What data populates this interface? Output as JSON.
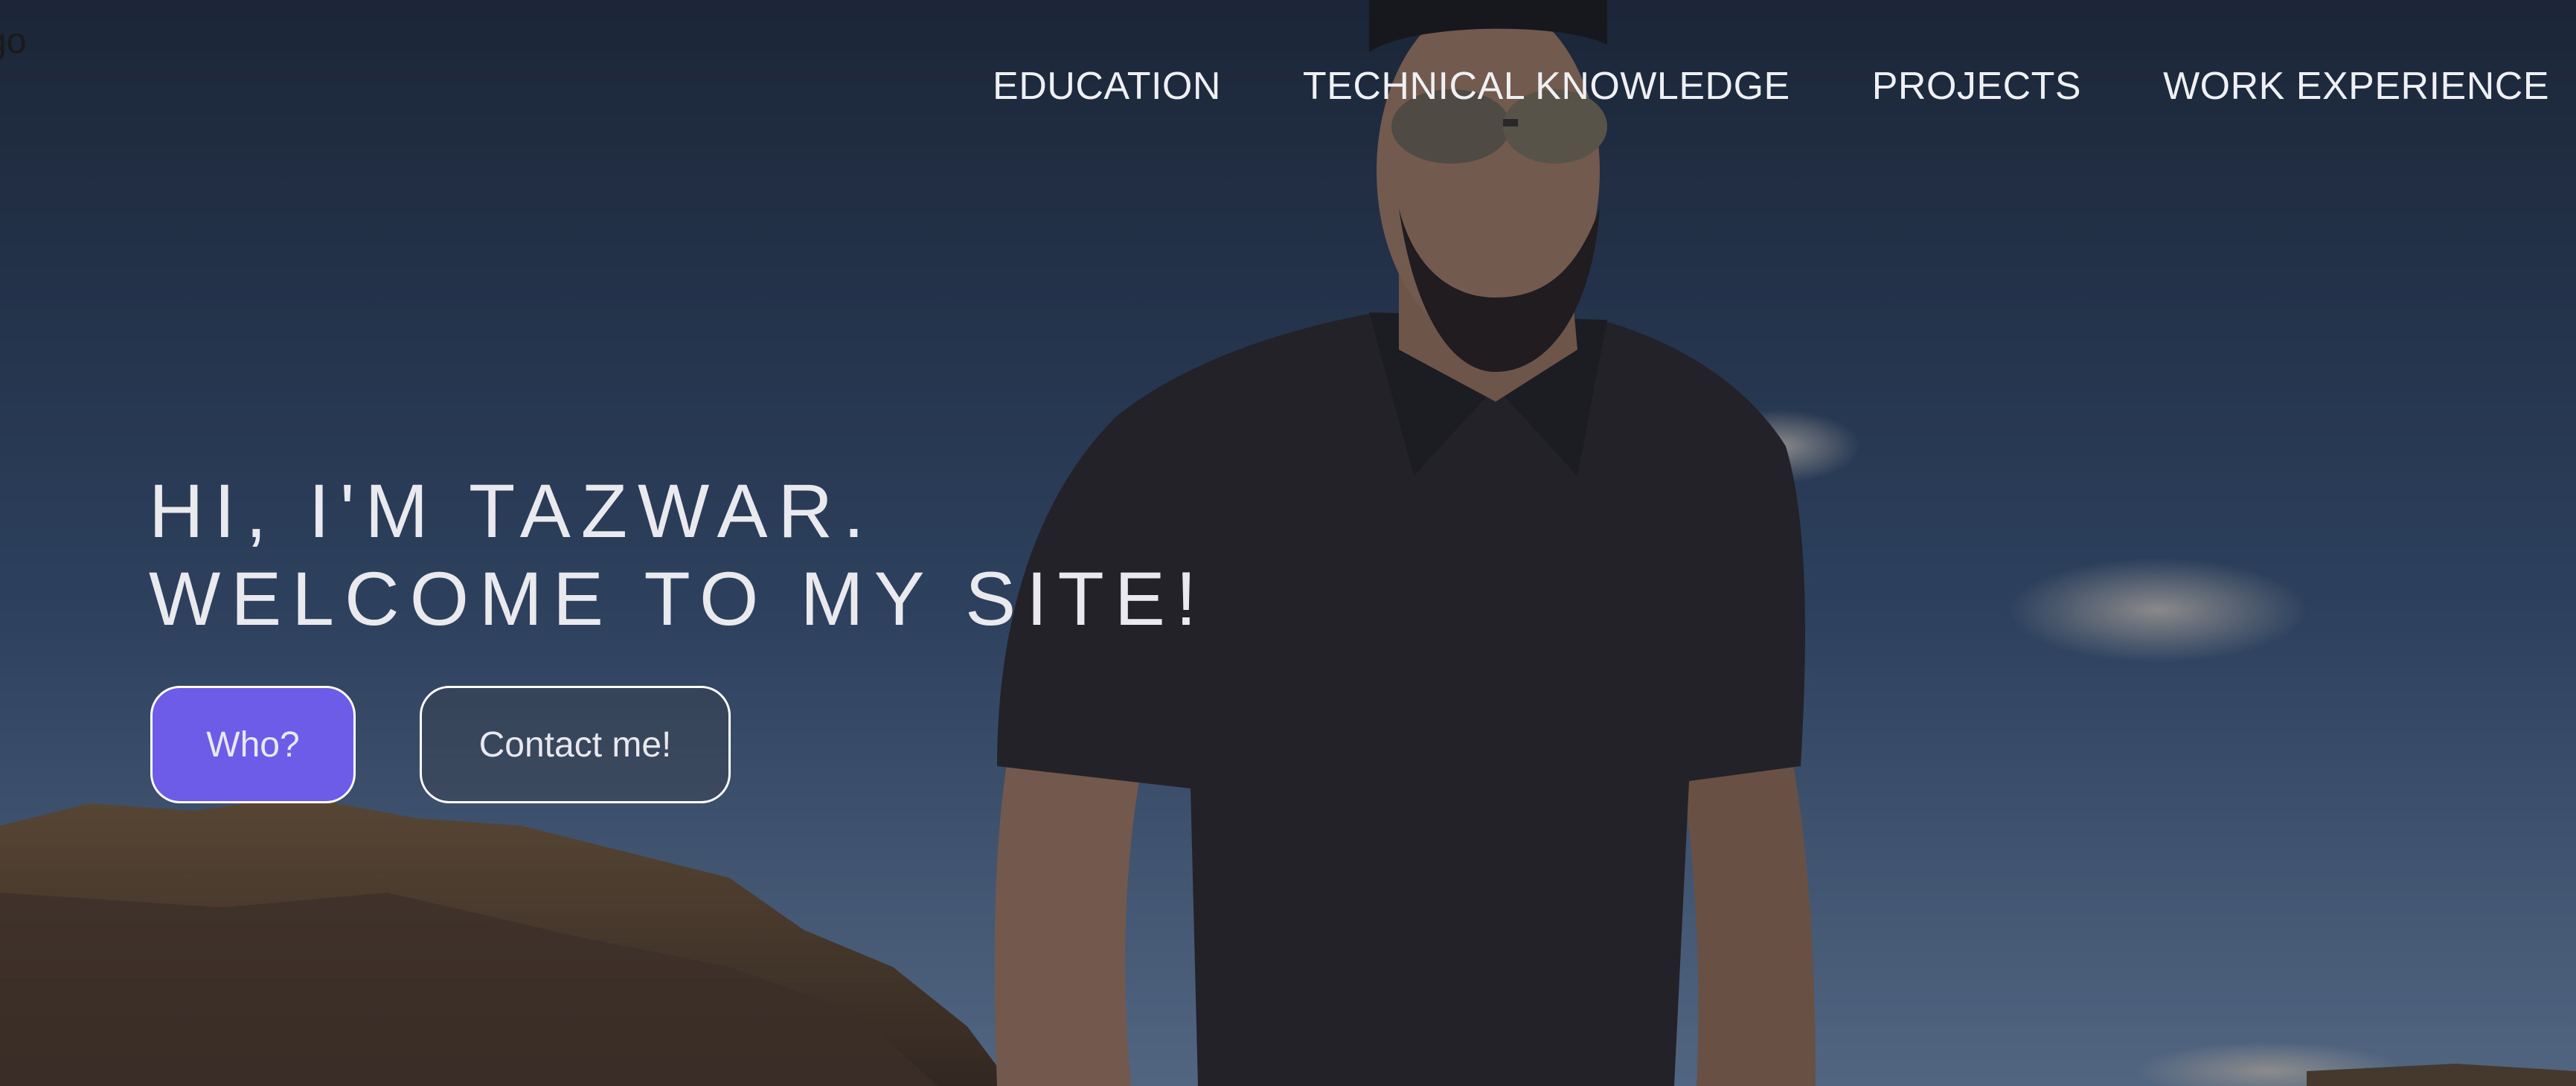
{
  "logo": {
    "text": "go"
  },
  "nav": {
    "items": [
      {
        "label": "EDUCATION"
      },
      {
        "label": "TECHNICAL KNOWLEDGE"
      },
      {
        "label": "PROJECTS"
      },
      {
        "label": "WORK EXPERIENCE"
      }
    ]
  },
  "hero": {
    "headline_line1": "HI, I'M TAZWAR.",
    "headline_line2": "WELCOME TO MY SITE!",
    "primary_button": "Who?",
    "secondary_button": "Contact me!"
  },
  "colors": {
    "accent": "#6c5ce7",
    "sky_top": "#2a3a52",
    "sky_bottom": "#6f8fb8",
    "rock": "#7a5a3a",
    "shirt": "#2a2a2e"
  }
}
